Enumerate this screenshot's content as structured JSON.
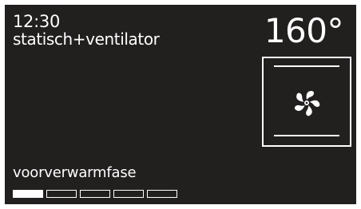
{
  "status": {
    "time": "12:30",
    "program": "statisch+ventilator",
    "temperature": "160°"
  },
  "oven_indicator": {
    "heating_elements": [
      "top",
      "bottom"
    ],
    "icon": "fan-icon"
  },
  "preheat": {
    "label": "voorverwarmfase",
    "segments_total": 5,
    "segments_completed": 1
  },
  "colors": {
    "screen_background": "#221f1f",
    "foreground": "#ffffff"
  }
}
